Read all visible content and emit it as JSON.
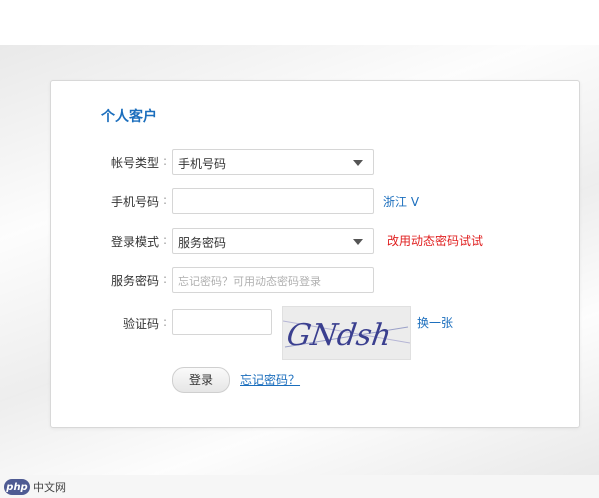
{
  "panel": {
    "title": "个人客户"
  },
  "form": {
    "account_type": {
      "label": "帐号类型",
      "value": "手机号码"
    },
    "phone": {
      "label": "手机号码",
      "value": "",
      "region_link": "浙江 V"
    },
    "login_mode": {
      "label": "登录模式",
      "value": "服务密码",
      "alt_link": "改用动态密码试试"
    },
    "service_password": {
      "label": "服务密码",
      "placeholder": "忘记密码？可用动态密码登录"
    },
    "captcha": {
      "label": "验证码",
      "value": "",
      "image_text": "GNdsh",
      "refresh_link": "换一张"
    },
    "login_button": "登录",
    "forgot_link": "忘记密码？"
  },
  "watermark": {
    "logo": "php",
    "text": "中文网"
  },
  "colors": {
    "title_blue": "#1b6ebd",
    "link_red": "#e02020",
    "panel_border": "#d8d8d8"
  },
  "icons": {
    "dropdown": "chevron-down-icon"
  }
}
